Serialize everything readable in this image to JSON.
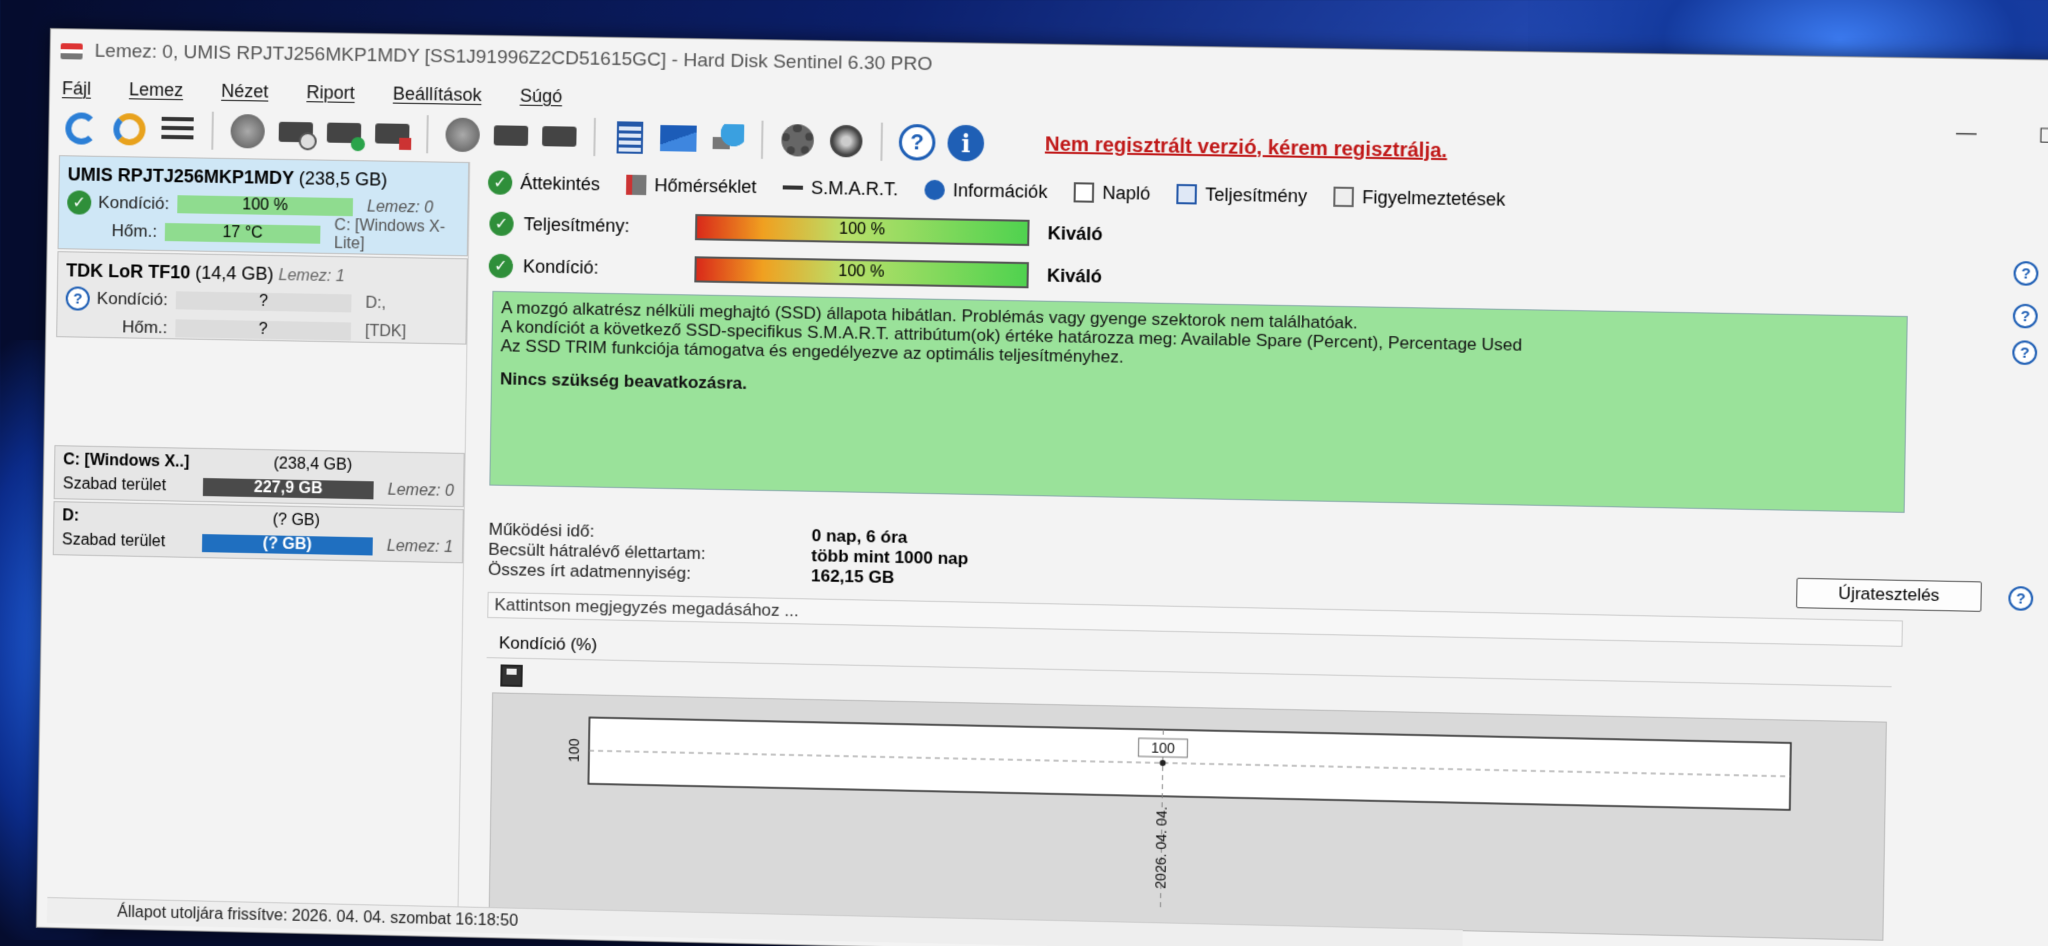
{
  "window": {
    "title": "Lemez: 0, UMIS RPJTJ256MKP1MDY [SS1J91996Z2CD51615GC]  -  Hard Disk Sentinel 6.30 PRO"
  },
  "menu": [
    "Fájl",
    "Lemez",
    "Nézet",
    "Riport",
    "Beállítások",
    "Súgó"
  ],
  "toolbar": {
    "register_notice": "Nem regisztrált verzió, kérem regisztrálja."
  },
  "disks": [
    {
      "name": "UMIS RPJTJ256MKP1MDY",
      "size": "(238,5 GB)",
      "lemez": "",
      "condition_label": "Kondíció:",
      "condition_value": "100 %",
      "condition_meta": "Lemez: 0",
      "temp_label": "Hőm.:",
      "temp_value": "17 °C",
      "temp_meta": "C: [Windows X-Lite]"
    },
    {
      "name": "TDK LoR TF10",
      "size": "(14,4 GB)",
      "lemez": "Lemez: 1",
      "condition_label": "Kondíció:",
      "condition_value": "?",
      "condition_meta": "D:,",
      "temp_label": "Hőm.:",
      "temp_value": "?",
      "temp_meta": "[TDK]"
    }
  ],
  "volumes": [
    {
      "name": "C: [Windows X..]",
      "size": "(238,4 GB)",
      "free_label": "Szabad terület",
      "free_value": "227,9 GB",
      "lemez": "Lemez: 0",
      "bar_color": "#4a4a4a"
    },
    {
      "name": "D:",
      "size": "(? GB)",
      "free_label": "Szabad terület",
      "free_value": "(? GB)",
      "lemez": "Lemez: 1",
      "bar_color": "#1f6fc0"
    }
  ],
  "tabs": [
    "Áttekintés",
    "Hőmérséklet",
    "S.M.A.R.T.",
    "Információk",
    "Napló",
    "Teljesítmény",
    "Figyelmeztetések"
  ],
  "summary": {
    "performance_label": "Teljesítmény:",
    "performance_value": "100 %",
    "performance_verdict": "Kiváló",
    "condition_label": "Kondíció:",
    "condition_value": "100 %",
    "condition_verdict": "Kiváló"
  },
  "message": {
    "line1": "A mozgó alkatrész nélküli meghajtó (SSD) állapota hibátlan. Problémás vagy gyenge szektorok nem találhatóak.",
    "line2": "A kondíciót a következő SSD-specifikus S.M.A.R.T. attribútum(ok) értéke határozza meg:  Available Spare (Percent), Percentage Used",
    "line3": "Az SSD TRIM funkciója támogatva és engedélyezve az optimális teljesítményhez.",
    "action": "Nincs szükség beavatkozásra."
  },
  "stats": [
    {
      "label": "Működési idő:",
      "value": "0 nap, 6 óra"
    },
    {
      "label": "Becsült hátralévő élettartam:",
      "value": "több mint 1000 nap"
    },
    {
      "label": "Összes írt adatmennyiség:",
      "value": "162,15 GB"
    }
  ],
  "retest_button": "Újratesztelés",
  "note_placeholder": "Kattintson megjegyzés megadásához ...",
  "chart_header": "Kondíció  (%)",
  "chart_data": {
    "type": "line",
    "x": [
      "2026. 04. 04."
    ],
    "series": [
      {
        "values": [
          100
        ]
      }
    ],
    "y_tick": "100",
    "point_label": "100",
    "grid": true
  },
  "status_bar": "Állapot utoljára frissítve: 2026. 04. 04. szombat 16:18:50"
}
